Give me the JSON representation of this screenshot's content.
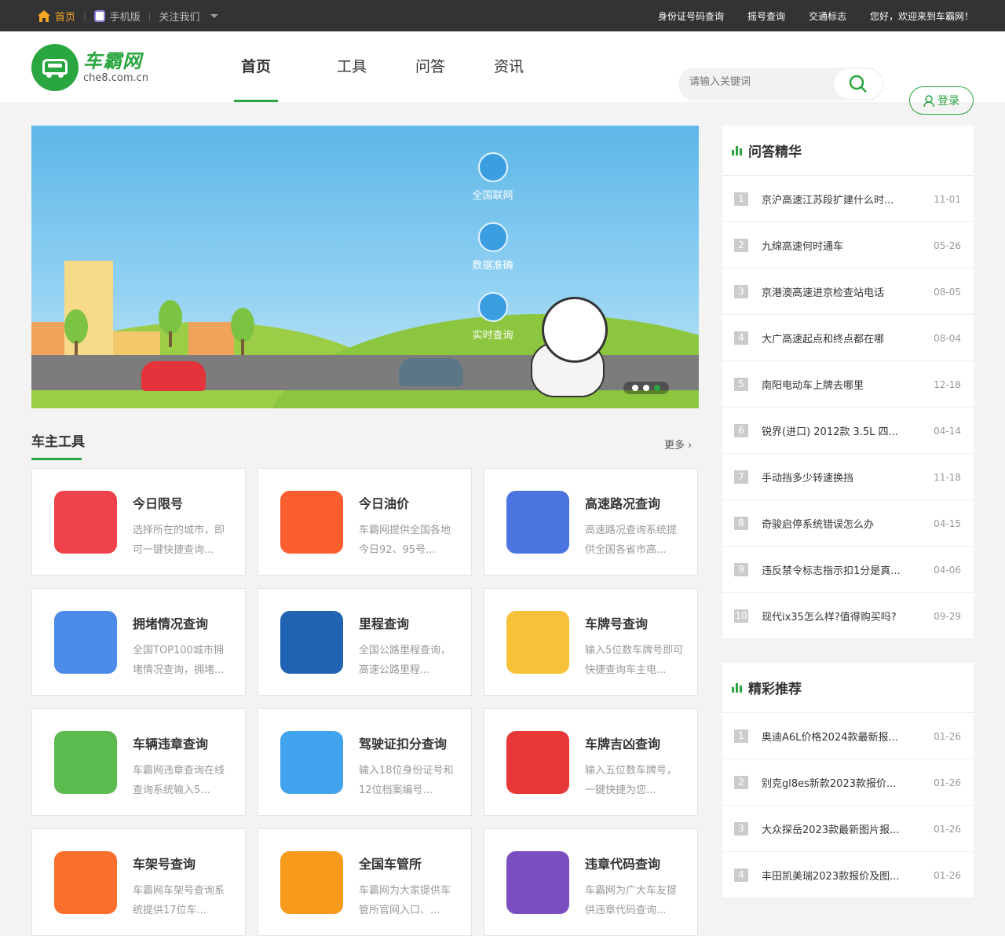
{
  "topbar": {
    "home": "首页",
    "mobile": "手机版",
    "follow": "关注我们",
    "links": [
      "身份证号码查询",
      "摇号查询",
      "交通标志",
      "您好，欢迎来到车霸网！"
    ]
  },
  "logo": {
    "cn": "车霸网",
    "en": "che8.com.cn"
  },
  "nav": [
    "首页",
    "工具",
    "问答",
    "资讯"
  ],
  "search": {
    "placeholder": "请输入关键词"
  },
  "login": "登录",
  "banner": {
    "features": [
      "全国联网",
      "数据准确",
      "实时查询"
    ]
  },
  "tools_section": {
    "title": "车主工具",
    "more": "更多"
  },
  "tools": [
    {
      "name": "今日限号",
      "desc": "选择所在的城市，即可一键快捷查询...",
      "color": "#f0424a",
      "icon": "no-car-icon"
    },
    {
      "name": "今日油价",
      "desc": "车霸网提供全国各地今日92、95号...",
      "color": "#fb5e2e",
      "icon": "fuel-pump-icon"
    },
    {
      "name": "高速路况查询",
      "desc": "高速路况查询系统提供全国各省市高...",
      "color": "#4c74e0",
      "icon": "highway-icon"
    },
    {
      "name": "拥堵情况查询",
      "desc": "全国TOP100城市拥堵情况查询，拥堵...",
      "color": "#4a8ae8",
      "icon": "jam-icon"
    },
    {
      "name": "里程查询",
      "desc": "全国公路里程查询，高速公路里程...",
      "color": "#1f63b2",
      "icon": "mileage-icon"
    },
    {
      "name": "车牌号查询",
      "desc": "输入5位数车牌号即可快捷查询车主电...",
      "color": "#f7c23a",
      "icon": "plate-icon"
    },
    {
      "name": "车辆违章查询",
      "desc": "车霸网违章查询在线查询系统输入5...",
      "color": "#5cbb4e",
      "icon": "map-pin-icon"
    },
    {
      "name": "驾驶证扣分查询",
      "desc": "输入18位身份证号和12位档案编号...",
      "color": "#42a4ee",
      "icon": "license-icon"
    },
    {
      "name": "车牌吉凶查询",
      "desc": "输入五位数车牌号，一键快捷为您...",
      "color": "#e73737",
      "icon": "bagua-icon"
    },
    {
      "name": "车架号查询",
      "desc": "车霸网车架号查询系统提供17位车...",
      "color": "#fb6f2d",
      "icon": "vin-icon"
    },
    {
      "name": "全国车管所",
      "desc": "车霸网为大家提供车管所官网入口、...",
      "color": "#f89b1c",
      "icon": "dmv-icon"
    },
    {
      "name": "违章代码查询",
      "desc": "车霸网为广大车友提供违章代码查询...",
      "color": "#7b4fc1",
      "icon": "violation-code-icon"
    }
  ],
  "qa": {
    "title": "问答精华",
    "items": [
      {
        "n": "1",
        "t": "京沪高速江苏段扩建什么时...",
        "d": "11-01"
      },
      {
        "n": "2",
        "t": "九绵高速何时通车",
        "d": "05-26"
      },
      {
        "n": "3",
        "t": "京港澳高速进京检查站电话",
        "d": "08-05"
      },
      {
        "n": "4",
        "t": "大广高速起点和终点都在哪",
        "d": "08-04"
      },
      {
        "n": "5",
        "t": "南阳电动车上牌去哪里",
        "d": "12-18"
      },
      {
        "n": "6",
        "t": "锐界(进口) 2012款 3.5L 四...",
        "d": "04-14"
      },
      {
        "n": "7",
        "t": "手动挡多少转速换挡",
        "d": "11-18"
      },
      {
        "n": "8",
        "t": "奇骏启停系统错误怎么办",
        "d": "04-15"
      },
      {
        "n": "9",
        "t": "违反禁令标志指示扣1分是真...",
        "d": "04-06"
      },
      {
        "n": "10",
        "t": "现代ix35怎么样?值得购买吗?",
        "d": "09-29"
      }
    ]
  },
  "rec": {
    "title": "精彩推荐",
    "items": [
      {
        "n": "1",
        "t": "奥迪A6L价格2024款最新报...",
        "d": "01-26"
      },
      {
        "n": "2",
        "t": "别克gl8es新款2023款报价...",
        "d": "01-26"
      },
      {
        "n": "3",
        "t": "大众探岳2023款最新图片报...",
        "d": "01-26"
      },
      {
        "n": "4",
        "t": "丰田凯美瑞2023款报价及图...",
        "d": "01-26"
      }
    ]
  }
}
